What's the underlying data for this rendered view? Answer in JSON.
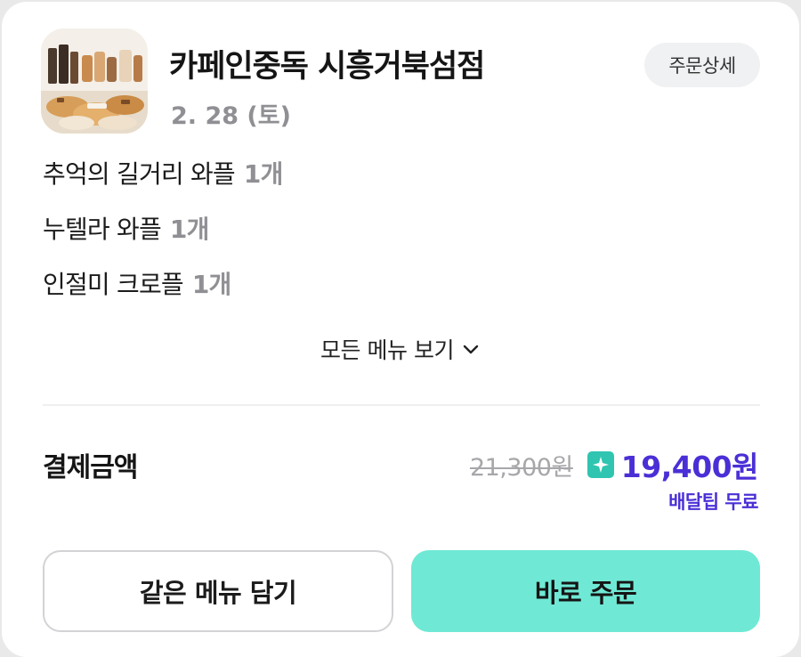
{
  "store": {
    "name": "카페인중독 시흥거북섬점",
    "date": "2. 28 (토)",
    "detail_label": "주문상세"
  },
  "menu": {
    "items": [
      {
        "name": "추억의 길거리 와플",
        "qty": "1개"
      },
      {
        "name": "누텔라 와플",
        "qty": "1개"
      },
      {
        "name": "인절미 크로플",
        "qty": "1개"
      }
    ],
    "see_all_label": "모든 메뉴 보기"
  },
  "payment": {
    "label": "결제금액",
    "original_price": "21,300원",
    "final_price": "19,400원",
    "delivery_tip": "배달팁 무료"
  },
  "actions": {
    "reorder_cart_label": "같은 메뉴 담기",
    "order_now_label": "바로 주문"
  },
  "colors": {
    "accent": "#4b2fd6",
    "primary_button": "#6fe9d5",
    "badge": "#2fc5b0"
  },
  "icons": {
    "thumbnail": "store-thumbnail-image",
    "chevron": "chevron-down-icon",
    "badge": "sparkle-badge-icon"
  }
}
